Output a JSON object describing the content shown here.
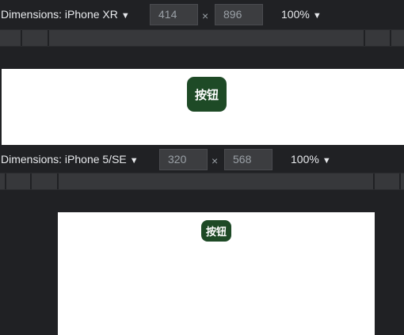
{
  "panels": [
    {
      "device_label": "Dimensions: iPhone XR",
      "width": "414",
      "height": "896",
      "times_sign": "×",
      "zoom": "100%",
      "button_label": "按钮"
    },
    {
      "device_label": "Dimensions: iPhone 5/SE",
      "width": "320",
      "height": "568",
      "times_sign": "×",
      "zoom": "100%",
      "button_label": "按钮"
    }
  ],
  "caret_glyph": "▼",
  "colors": {
    "background": "#202124",
    "toolbar_input": "#3c3d40",
    "button": "#1e4a26",
    "viewport": "#ffffff"
  }
}
